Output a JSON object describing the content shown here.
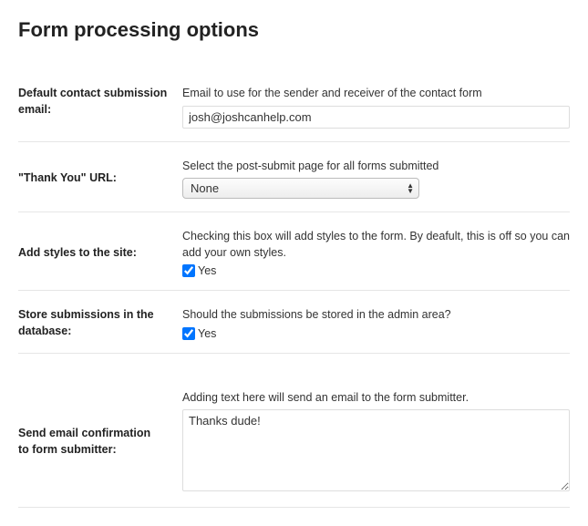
{
  "title": "Form processing options",
  "fields": {
    "email": {
      "label": "Default contact submission email:",
      "desc": "Email to use for the sender and receiver of the contact form",
      "value": "josh@joshcanhelp.com"
    },
    "thankyou": {
      "label": "\"Thank You\" URL:",
      "desc": "Select the post-submit page for all forms submitted",
      "selected": "None"
    },
    "styles": {
      "label": "Add styles to the site:",
      "desc": "Checking this box will add styles to the form. By deafult, this is off so you can add your own styles.",
      "checkbox_label": "Yes",
      "checked": true
    },
    "store": {
      "label": "Store submissions in the database:",
      "desc": "Should the submissions be stored in the admin area?",
      "checkbox_label": "Yes",
      "checked": true
    },
    "confirm": {
      "label": "Send email confirmation\nto form submitter:",
      "desc": "Adding text here will send an email to the form submitter.",
      "value": "Thanks dude!"
    }
  }
}
